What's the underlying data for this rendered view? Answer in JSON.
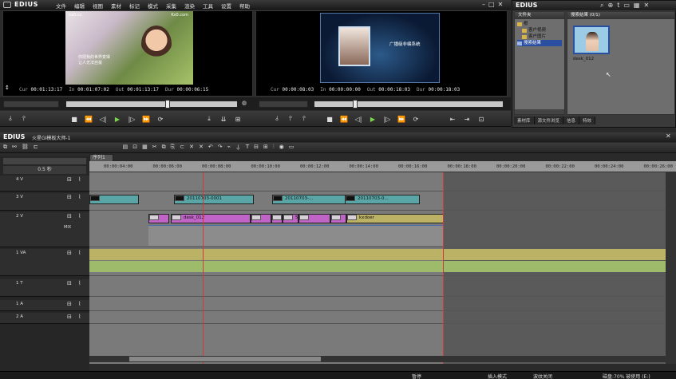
{
  "app": {
    "logo": "EDIUS",
    "menu": [
      "文件",
      "编辑",
      "视图",
      "素材",
      "标记",
      "模式",
      "采集",
      "渲染",
      "工具",
      "设置",
      "帮助"
    ],
    "bin_logo": "EDIUS"
  },
  "player": {
    "overlay_top_left": "kx0.co",
    "overlay_top_right": "Kx0.com",
    "overlay_text": "你把我的世界变得\n让人无法自拔",
    "cur": "00:01:13:17",
    "in": "00:01:07:02",
    "out": "00:01:13:17",
    "dur": "00:00:06:15"
  },
  "recorder": {
    "overlay_text": "广播级非编系统",
    "cur": "00:00:08:03",
    "in": "00:00:00:00",
    "out": "00:00:18:03",
    "dur": "00:00:18:03"
  },
  "labels": {
    "cur": "Cur",
    "in": "In",
    "out": "Out",
    "dur": "Dur"
  },
  "bin": {
    "folder_panel_title": "文件夹",
    "search_panel_title": "搜索结果 (0/1)",
    "tree": [
      "根",
      "客户视频",
      "客户图片",
      "搜索结果"
    ],
    "clip_name": "desk_012",
    "tabs": [
      "素材库",
      "源文件浏览",
      "信息",
      "特效"
    ]
  },
  "timeline": {
    "logo": "EDIUS",
    "project_name": "火星GI模板大师-1",
    "sequence_tab": "序列1",
    "zoom_label": "0.5 秒",
    "ruler_ticks": [
      "00:00:04:00",
      "00:00:06:00",
      "00:00:08:00",
      "00:00:10:00",
      "00:00:12:00",
      "00:00:14:00",
      "00:00:16:00",
      "00:00:18:00",
      "00:00:20:00",
      "00:00:22:00",
      "00:00:24:00",
      "00:00:26:00"
    ],
    "tracks": [
      {
        "name": "4 V"
      },
      {
        "name": "3 V"
      },
      {
        "name": "2 V",
        "mix": "MIX"
      },
      {
        "name": "1 VA"
      },
      {
        "name": "1 T"
      },
      {
        "name": "1 A"
      },
      {
        "name": "2 A"
      }
    ],
    "clips_3v": [
      "20110703-0001",
      "20110703-...",
      "20110703-0..."
    ],
    "clips_2v": [
      "desk_012",
      "5f...",
      "kxdoer"
    ]
  },
  "status": {
    "pause": "暂停",
    "insert_mode": "插入模式",
    "ripple": "波纹关闭",
    "disk": "磁盘:70% 被使用 (E:)"
  },
  "colors": {
    "play_green": "#7cd64c",
    "clip_teal": "#5aa6a6",
    "clip_pink": "#c064c8",
    "playhead_red": "#d23a3a"
  }
}
